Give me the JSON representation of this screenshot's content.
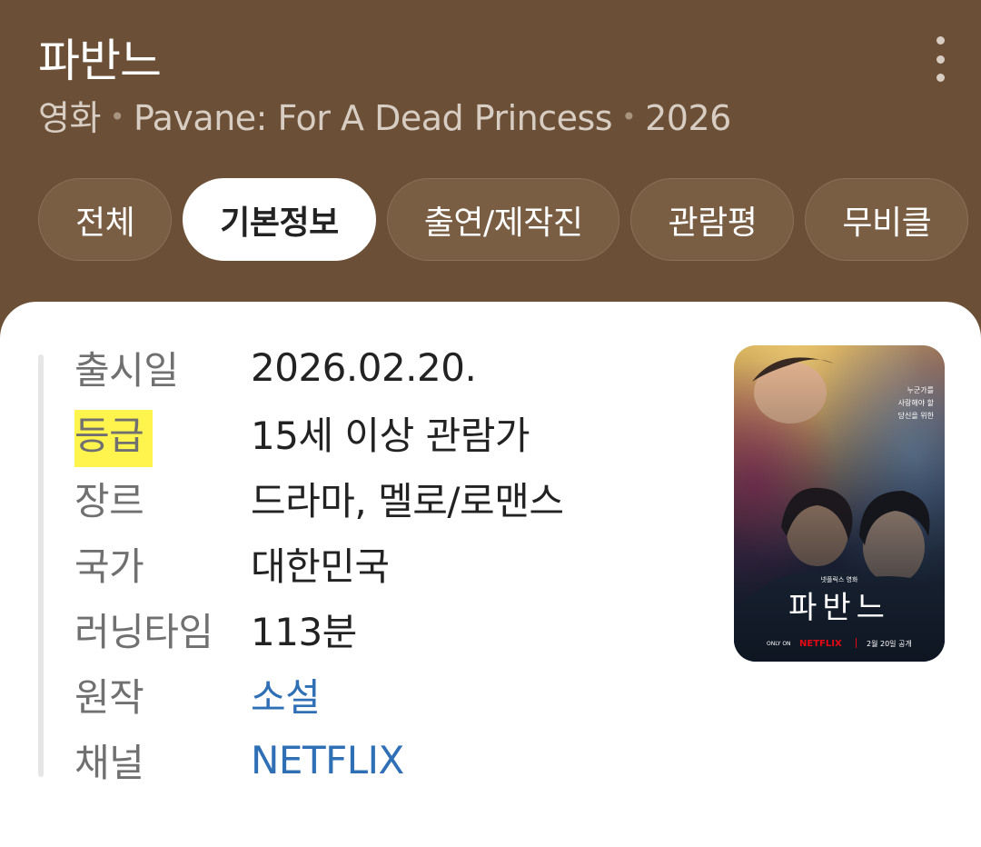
{
  "header": {
    "title": "파반느",
    "subtitle": {
      "type": "영화",
      "original_title": "Pavane: For A Dead Princess",
      "year": "2026",
      "separator": "•"
    }
  },
  "tabs": [
    {
      "label": "전체",
      "active": false
    },
    {
      "label": "기본정보",
      "active": true
    },
    {
      "label": "출연/제작진",
      "active": false
    },
    {
      "label": "관람평",
      "active": false
    },
    {
      "label": "무비클",
      "active": false
    }
  ],
  "info": {
    "rows": [
      {
        "label": "출시일",
        "value": "2026.02.20."
      },
      {
        "label": "등급",
        "value": "15세 이상 관람가"
      },
      {
        "label": "장르",
        "value": "드라마, 멜로/로맨스"
      },
      {
        "label": "국가",
        "value": "대한민국"
      },
      {
        "label": "러닝타임",
        "value": "113분"
      },
      {
        "label": "원작",
        "value": "소설"
      },
      {
        "label": "채널",
        "value": "NETFLIX"
      }
    ]
  },
  "poster": {
    "top_copy": [
      "누군가를",
      "사랑해야 할",
      "당신을 위한"
    ],
    "small_copy": "넷플릭스 영화",
    "title": "파반느",
    "only_on": "ONLY ON",
    "brand": "NETFLIX",
    "release": "2월 20일 공개"
  }
}
